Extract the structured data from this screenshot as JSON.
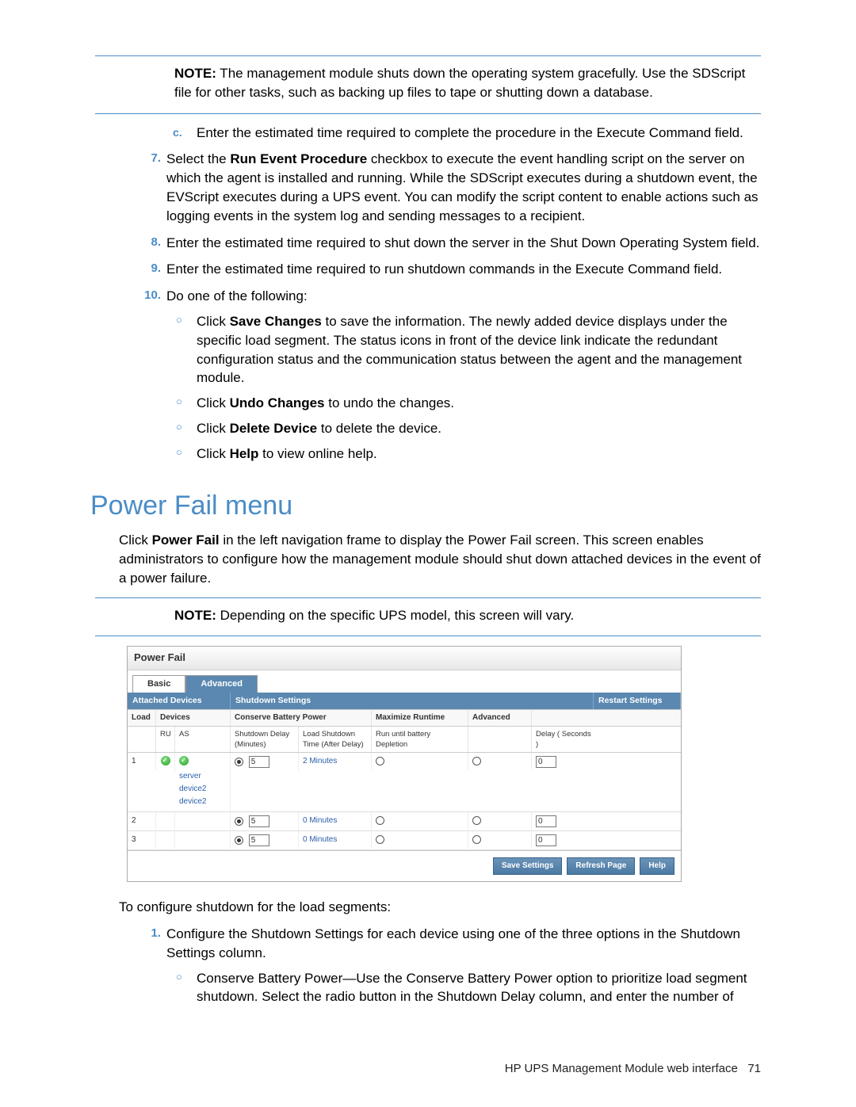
{
  "note1_label": "NOTE:",
  "note1_text": " The management module shuts down the operating system gracefully. Use the SDScript file for other tasks, such as backing up files to tape or shutting down a database.",
  "item_c_marker": "c.",
  "item_c": "Enter the estimated time required to complete the procedure in the Execute Command field.",
  "item7_marker": "7.",
  "item7_a": "Select the ",
  "item7_bold": "Run Event Procedure",
  "item7_b": " checkbox to execute the event handling script on the server on which the agent is installed and running. While the SDScript executes during a shutdown event, the EVScript executes during a UPS event. You can modify the script content to enable actions such as logging events in the system log and sending messages to a recipient.",
  "item8_marker": "8.",
  "item8": "Enter the estimated time required to shut down the server in the Shut Down Operating System field.",
  "item9_marker": "9.",
  "item9": "Enter the estimated time required to run shutdown commands in the Execute Command field.",
  "item10_marker": "10.",
  "item10": "Do one of the following:",
  "sub10a_a": "Click ",
  "sub10a_bold": "Save Changes",
  "sub10a_b": " to save the information. The newly added device displays under the specific load segment. The status icons in front of the device link indicate the redundant configuration status and the communication status between the agent and the management module.",
  "sub10b_a": "Click ",
  "sub10b_bold": "Undo Changes",
  "sub10b_b": " to undo the changes.",
  "sub10c_a": "Click ",
  "sub10c_bold": "Delete Device",
  "sub10c_b": " to delete the device.",
  "sub10d_a": "Click ",
  "sub10d_bold": "Help",
  "sub10d_b": " to view online help.",
  "heading": "Power Fail menu",
  "intro_a": "Click ",
  "intro_bold": "Power Fail",
  "intro_b": " in the left navigation frame to display the Power Fail screen. This screen enables administrators to configure how the management module should shut down attached devices in the event of a power failure.",
  "note2_label": "NOTE:",
  "note2_text": " Depending on the specific UPS model, this screen will vary.",
  "shot": {
    "title": "Power Fail",
    "tab_basic": "Basic",
    "tab_advanced": "Advanced",
    "sec_attached": "Attached Devices",
    "sec_shutdown": "Shutdown Settings",
    "sec_restart": "Restart Settings",
    "hdr_load": "Load",
    "hdr_devices": "Devices",
    "hdr_conserve": "Conserve Battery Power",
    "hdr_max": "Maximize Runtime",
    "hdr_adv": "Advanced",
    "hdr_ru": "RU",
    "hdr_as": "AS",
    "hdr_sd": "Shutdown Delay (Minutes)",
    "hdr_lst": "Load Shutdown Time (After Delay)",
    "hdr_run": "Run until battery Depletion",
    "hdr_delay": "Delay ( Seconds )",
    "rows": [
      {
        "load": "1",
        "dev": [
          "server",
          "device2",
          "device2"
        ],
        "sd": "5",
        "lst": "2 Minutes",
        "rest": "0",
        "hasIcons": true
      },
      {
        "load": "2",
        "dev": [],
        "sd": "5",
        "lst": "0 Minutes",
        "rest": "0",
        "hasIcons": false
      },
      {
        "load": "3",
        "dev": [],
        "sd": "5",
        "lst": "0 Minutes",
        "rest": "0",
        "hasIcons": false
      }
    ],
    "btn_save": "Save Settings",
    "btn_refresh": "Refresh Page",
    "btn_help": "Help"
  },
  "config_intro": "To configure shutdown for the load segments:",
  "config1_marker": "1.",
  "config1": "Configure the Shutdown Settings for each device using one of the three options in the Shutdown Settings column.",
  "config1a": "Conserve Battery Power—Use the Conserve Battery Power option to prioritize load segment shutdown. Select the radio button in the Shutdown Delay column, and enter the number of",
  "footer_text": "HP UPS Management Module web interface",
  "footer_page": "71"
}
